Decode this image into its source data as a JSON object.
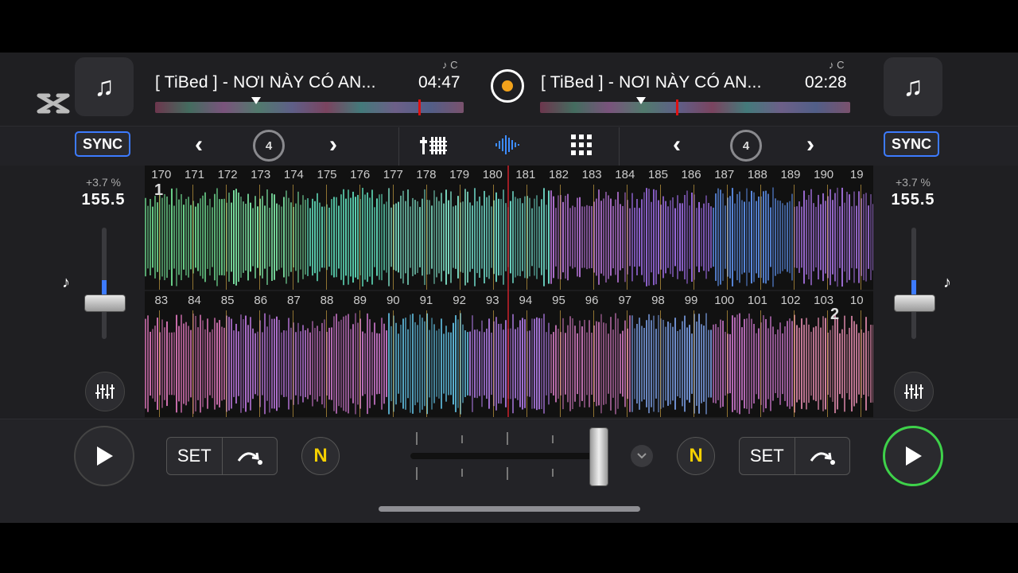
{
  "deck_left": {
    "title": "[ TiBed ] - NƠI NÀY CÓ AN...",
    "time": "04:47",
    "key": "♪ C",
    "sync_label": "SYNC",
    "pitch": "+3.7 %",
    "bpm": "155.5",
    "loop_size": "4",
    "beat_numbers": [
      "170",
      "171",
      "172",
      "173",
      "174",
      "175",
      "176",
      "177",
      "178",
      "179",
      "180",
      "181",
      "182",
      "183",
      "184",
      "185",
      "186",
      "187",
      "188",
      "189",
      "190",
      "19"
    ],
    "deck_number": "1",
    "set_label": "SET"
  },
  "deck_right": {
    "title": "[ TiBed ] - NƠI NÀY CÓ AN...",
    "time": "02:28",
    "key": "♪ C",
    "sync_label": "SYNC",
    "pitch": "+3.7 %",
    "bpm": "155.5",
    "loop_size": "4",
    "beat_numbers": [
      "83",
      "84",
      "85",
      "86",
      "87",
      "88",
      "89",
      "90",
      "91",
      "92",
      "93",
      "94",
      "95",
      "96",
      "97",
      "98",
      "99",
      "100",
      "101",
      "102",
      "103",
      "10"
    ],
    "deck_number": "2",
    "set_label": "SET"
  },
  "colors": {
    "sync_border": "#3d7bff",
    "play_active": "#3ed14a",
    "center_dot": "#f2a21b",
    "n_icon": "#f5d000"
  },
  "crossfader_position": 1.0
}
